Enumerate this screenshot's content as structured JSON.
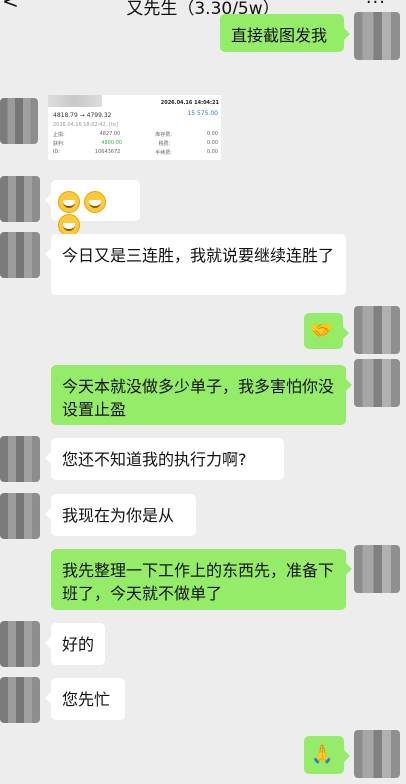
{
  "header": {
    "title": "又先生（3.30/5w）",
    "back": "<",
    "more": "···"
  },
  "top_message": {
    "text": "直接截图发我"
  },
  "shot": {
    "date": "2026.04.16 14:04:21",
    "pair": "4818.79 → 4799.32",
    "amount": "15 575.00",
    "subline": "2026.04.16 18:02:42, [to]",
    "row1_left": "止损:",
    "row1_mid": "4827.00",
    "row1_right_label": "库存费:",
    "row1_right_value": "0.00",
    "row2_left": "获利:",
    "row2_mid": "4800.00",
    "row2_right_label": "税费:",
    "row2_right_value": "0.00",
    "row3_left": "ID:",
    "row3_mid": "10643672",
    "row3_right_label": "手续费:",
    "row3_right_value": "0.00"
  },
  "messages": [
    {
      "text": "今日又是三连胜，我就说要继续连胜了"
    },
    {
      "text": "今天本就没做多少单子，我多害怕你没设置止盈"
    },
    {
      "text": "您还不知道我的执行力啊?"
    },
    {
      "text": "我现在为你是从"
    },
    {
      "text": "我先整理一下工作上的东西先，准备下班了，今天就不做单了"
    },
    {
      "text": "好的"
    },
    {
      "text": "您先忙"
    }
  ],
  "emoji": {
    "grins": "😁😁😁",
    "handshake": "🤝",
    "pray": "🙏"
  }
}
